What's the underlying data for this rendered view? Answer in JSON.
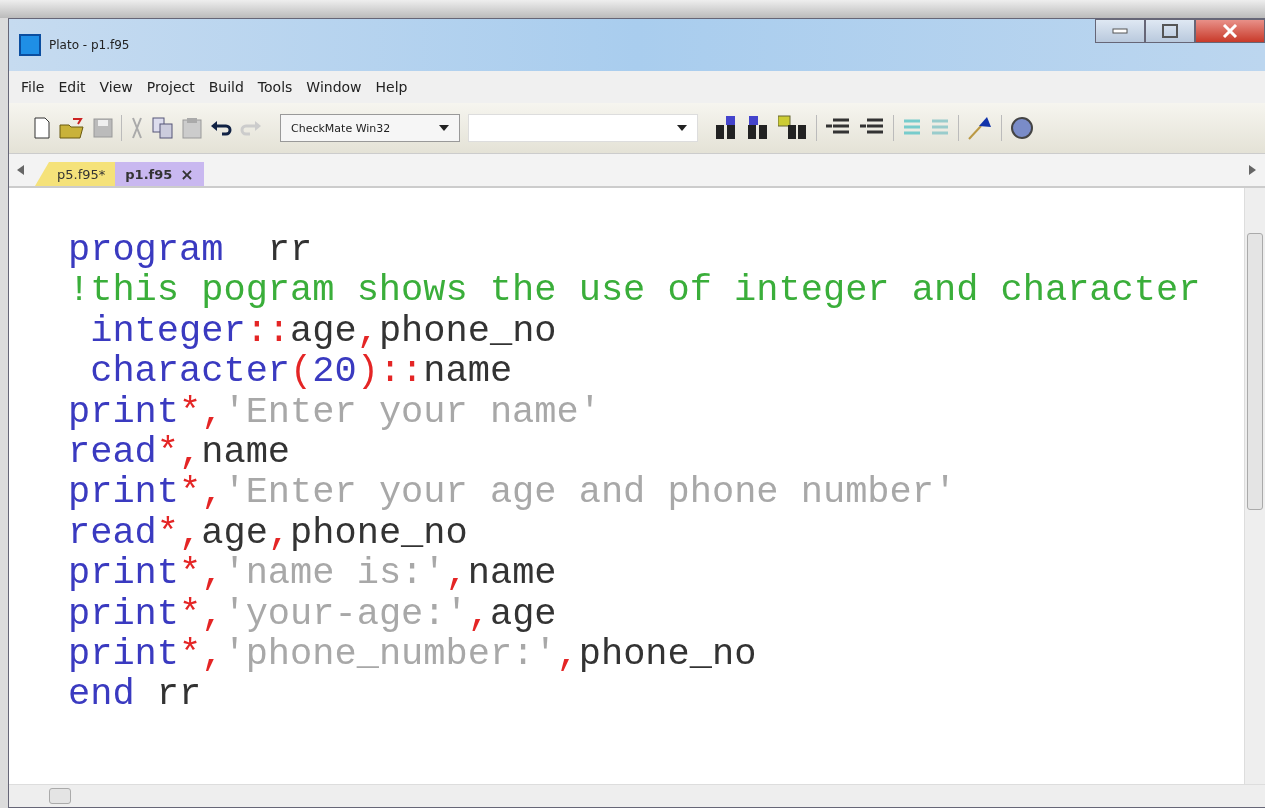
{
  "window": {
    "title": "Plato - p1.f95"
  },
  "menu": [
    "File",
    "Edit",
    "View",
    "Project",
    "Build",
    "Tools",
    "Window",
    "Help"
  ],
  "toolbar": {
    "config_combo": "CheckMate Win32"
  },
  "tabs": [
    {
      "label": "p5.f95*",
      "selected": false,
      "color": "#f5e27a"
    },
    {
      "label": "p1.f95",
      "selected": true,
      "color": "#c9b8f0",
      "close": "×"
    }
  ],
  "editor": {
    "lines": [
      [
        {
          "kind": "keyword",
          "text": "program"
        },
        {
          "kind": "plain",
          "text": "  rr"
        }
      ],
      [
        {
          "kind": "comment",
          "text": "!this pogram shows the use of integer and character"
        }
      ],
      [
        {
          "kind": "keyword",
          "text": " integer"
        },
        {
          "kind": "operator",
          "text": "::"
        },
        {
          "kind": "plain",
          "text": "age"
        },
        {
          "kind": "operator",
          "text": ","
        },
        {
          "kind": "plain",
          "text": "phone_no"
        }
      ],
      [
        {
          "kind": "keyword",
          "text": " character"
        },
        {
          "kind": "operator",
          "text": "("
        },
        {
          "kind": "keyword",
          "text": "20"
        },
        {
          "kind": "operator",
          "text": ")::"
        },
        {
          "kind": "plain",
          "text": "name"
        }
      ],
      [
        {
          "kind": "keyword",
          "text": "print"
        },
        {
          "kind": "operator",
          "text": "*,"
        },
        {
          "kind": "string",
          "text": "'Enter your name'"
        }
      ],
      [
        {
          "kind": "keyword",
          "text": "read"
        },
        {
          "kind": "operator",
          "text": "*,"
        },
        {
          "kind": "plain",
          "text": "name"
        }
      ],
      [
        {
          "kind": "keyword",
          "text": "print"
        },
        {
          "kind": "operator",
          "text": "*,"
        },
        {
          "kind": "string",
          "text": "'Enter your age and phone number'"
        }
      ],
      [
        {
          "kind": "keyword",
          "text": "read"
        },
        {
          "kind": "operator",
          "text": "*,"
        },
        {
          "kind": "plain",
          "text": "age"
        },
        {
          "kind": "operator",
          "text": ","
        },
        {
          "kind": "plain",
          "text": "phone_no"
        }
      ],
      [
        {
          "kind": "keyword",
          "text": "print"
        },
        {
          "kind": "operator",
          "text": "*,"
        },
        {
          "kind": "string",
          "text": "'name is:'"
        },
        {
          "kind": "operator",
          "text": ","
        },
        {
          "kind": "plain",
          "text": "name"
        }
      ],
      [
        {
          "kind": "keyword",
          "text": "print"
        },
        {
          "kind": "operator",
          "text": "*,"
        },
        {
          "kind": "string",
          "text": "'your-age:'"
        },
        {
          "kind": "operator",
          "text": ","
        },
        {
          "kind": "plain",
          "text": "age"
        }
      ],
      [
        {
          "kind": "keyword",
          "text": "print"
        },
        {
          "kind": "operator",
          "text": "*,"
        },
        {
          "kind": "string",
          "text": "'phone_number:'"
        },
        {
          "kind": "operator",
          "text": ","
        },
        {
          "kind": "plain",
          "text": "phone_no"
        }
      ],
      [
        {
          "kind": "keyword",
          "text": "end"
        },
        {
          "kind": "plain",
          "text": " rr"
        }
      ]
    ]
  }
}
